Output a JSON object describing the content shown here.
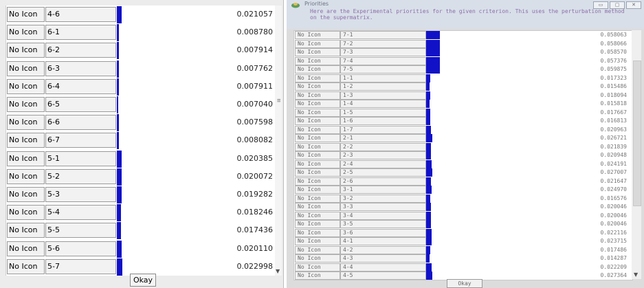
{
  "left": {
    "rows": [
      {
        "icon": "No Icon",
        "name": "4-6",
        "value": "0.021057",
        "bar": 0.021057
      },
      {
        "icon": "No Icon",
        "name": "6-1",
        "value": "0.008780",
        "bar": 0.00878
      },
      {
        "icon": "No Icon",
        "name": "6-2",
        "value": "0.007914",
        "bar": 0.007914
      },
      {
        "icon": "No Icon",
        "name": "6-3",
        "value": "0.007762",
        "bar": 0.007762
      },
      {
        "icon": "No Icon",
        "name": "6-4",
        "value": "0.007911",
        "bar": 0.007911
      },
      {
        "icon": "No Icon",
        "name": "6-5",
        "value": "0.007040",
        "bar": 0.00704
      },
      {
        "icon": "No Icon",
        "name": "6-6",
        "value": "0.007598",
        "bar": 0.007598
      },
      {
        "icon": "No Icon",
        "name": "6-7",
        "value": "0.008082",
        "bar": 0.008082
      },
      {
        "icon": "No Icon",
        "name": "5-1",
        "value": "0.020385",
        "bar": 0.020385
      },
      {
        "icon": "No Icon",
        "name": "5-2",
        "value": "0.020072",
        "bar": 0.020072
      },
      {
        "icon": "No Icon",
        "name": "5-3",
        "value": "0.019282",
        "bar": 0.019282
      },
      {
        "icon": "No Icon",
        "name": "5-4",
        "value": "0.018246",
        "bar": 0.018246
      },
      {
        "icon": "No Icon",
        "name": "5-5",
        "value": "0.017436",
        "bar": 0.017436
      },
      {
        "icon": "No Icon",
        "name": "5-6",
        "value": "0.020110",
        "bar": 0.02011
      },
      {
        "icon": "No Icon",
        "name": "5-7",
        "value": "0.022998",
        "bar": 0.022998
      }
    ],
    "okay_label": "Okay"
  },
  "dialog": {
    "title": "Priorities",
    "description": "Here are the Experimental priorities for the given criterion. This uses the perturbation method on the supermatrix.",
    "rows": [
      {
        "icon": "No Icon",
        "name": "7-1",
        "value": "0.058063",
        "bar": 0.058063
      },
      {
        "icon": "No Icon",
        "name": "7-2",
        "value": "0.058066",
        "bar": 0.058066
      },
      {
        "icon": "No Icon",
        "name": "7-3",
        "value": "0.058570",
        "bar": 0.05857
      },
      {
        "icon": "No Icon",
        "name": "7-4",
        "value": "0.057376",
        "bar": 0.057376
      },
      {
        "icon": "No Icon",
        "name": "7-5",
        "value": "0.059875",
        "bar": 0.059875
      },
      {
        "icon": "No Icon",
        "name": "1-1",
        "value": "0.017323",
        "bar": 0.017323
      },
      {
        "icon": "No Icon",
        "name": "1-2",
        "value": "0.015486",
        "bar": 0.015486
      },
      {
        "icon": "No Icon",
        "name": "1-3",
        "value": "0.018094",
        "bar": 0.018094
      },
      {
        "icon": "No Icon",
        "name": "1-4",
        "value": "0.015818",
        "bar": 0.015818
      },
      {
        "icon": "No Icon",
        "name": "1-5",
        "value": "0.017667",
        "bar": 0.017667
      },
      {
        "icon": "No Icon",
        "name": "1-6",
        "value": "0.016813",
        "bar": 0.016813
      },
      {
        "icon": "No Icon",
        "name": "1-7",
        "value": "0.020963",
        "bar": 0.020963
      },
      {
        "icon": "No Icon",
        "name": "2-1",
        "value": "0.026721",
        "bar": 0.026721
      },
      {
        "icon": "No Icon",
        "name": "2-2",
        "value": "0.021839",
        "bar": 0.021839
      },
      {
        "icon": "No Icon",
        "name": "2-3",
        "value": "0.020948",
        "bar": 0.020948
      },
      {
        "icon": "No Icon",
        "name": "2-4",
        "value": "0.024191",
        "bar": 0.024191
      },
      {
        "icon": "No Icon",
        "name": "2-5",
        "value": "0.027007",
        "bar": 0.027007
      },
      {
        "icon": "No Icon",
        "name": "2-6",
        "value": "0.021647",
        "bar": 0.021647
      },
      {
        "icon": "No Icon",
        "name": "3-1",
        "value": "0.024970",
        "bar": 0.02497
      },
      {
        "icon": "No Icon",
        "name": "3-2",
        "value": "0.016576",
        "bar": 0.016576
      },
      {
        "icon": "No Icon",
        "name": "3-3",
        "value": "0.020046",
        "bar": 0.020046
      },
      {
        "icon": "No Icon",
        "name": "3-4",
        "value": "0.020046",
        "bar": 0.020046
      },
      {
        "icon": "No Icon",
        "name": "3-5",
        "value": "0.020046",
        "bar": 0.020046
      },
      {
        "icon": "No Icon",
        "name": "3-6",
        "value": "0.022116",
        "bar": 0.022116
      },
      {
        "icon": "No Icon",
        "name": "4-1",
        "value": "0.023715",
        "bar": 0.023715
      },
      {
        "icon": "No Icon",
        "name": "4-2",
        "value": "0.017486",
        "bar": 0.017486
      },
      {
        "icon": "No Icon",
        "name": "4-3",
        "value": "0.014287",
        "bar": 0.014287
      },
      {
        "icon": "No Icon",
        "name": "4-4",
        "value": "0.022209",
        "bar": 0.022209
      },
      {
        "icon": "No Icon",
        "name": "4-5",
        "value": "0.027364",
        "bar": 0.027364
      }
    ],
    "okay_label": "Okay"
  },
  "colors": {
    "bar": "#1111c8",
    "description_text": "#8b6fa8"
  }
}
